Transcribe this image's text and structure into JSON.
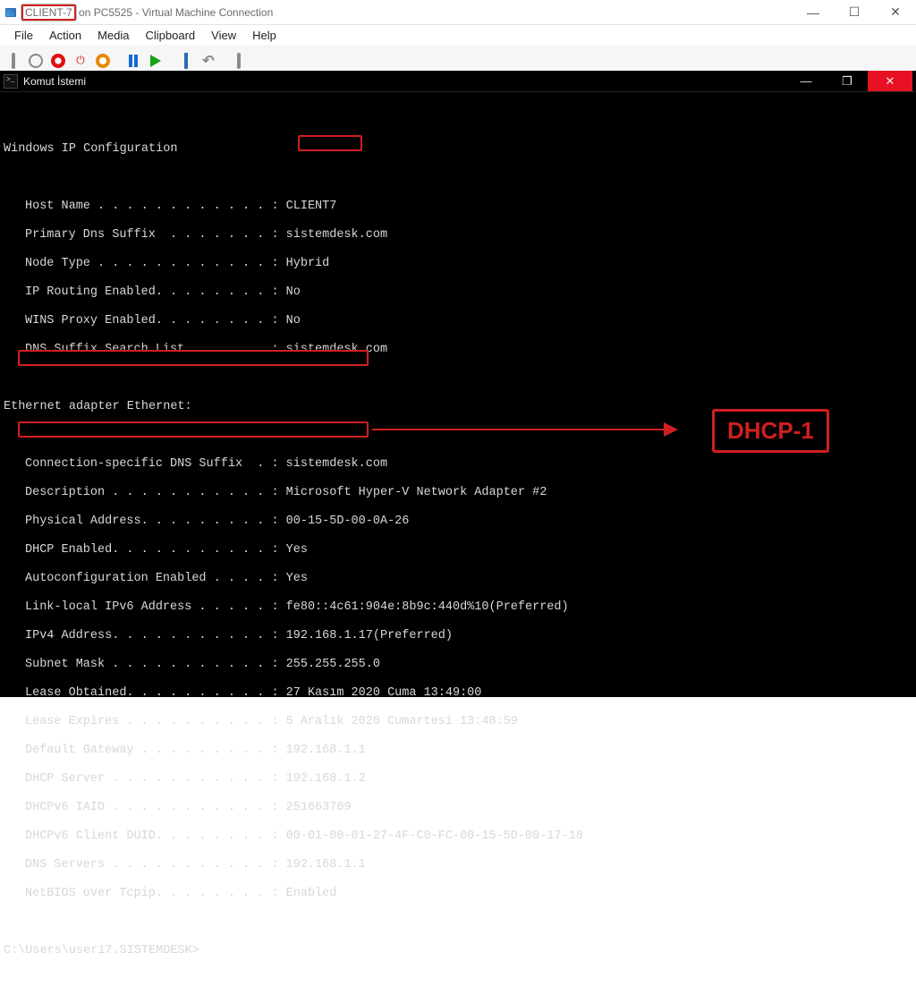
{
  "outer": {
    "title_highlight": "CLIENT-7",
    "title_rest": "on PC5525 - Virtual Machine Connection",
    "menu": [
      "File",
      "Action",
      "Media",
      "Clipboard",
      "View",
      "Help"
    ],
    "winbtn_min": "—",
    "winbtn_max": "☐",
    "winbtn_close": "✕"
  },
  "cmd": {
    "title": "Komut İstemi",
    "winbtn_min": "—",
    "winbtn_max": "❐",
    "winbtn_close": "✕",
    "section_winip": "Windows IP Configuration",
    "lines_winip": [
      {
        "key": "Host Name . . . . . . . . . . . . :",
        "val": " CLIENT7"
      },
      {
        "key": "Primary Dns Suffix  . . . . . . . :",
        "val": " sistemdesk.com"
      },
      {
        "key": "Node Type . . . . . . . . . . . . :",
        "val": " Hybrid"
      },
      {
        "key": "IP Routing Enabled. . . . . . . . :",
        "val": " No"
      },
      {
        "key": "WINS Proxy Enabled. . . . . . . . :",
        "val": " No"
      },
      {
        "key": "DNS Suffix Search List. . . . . . :",
        "val": " sistemdesk.com"
      }
    ],
    "section_eth": "Ethernet adapter Ethernet:",
    "lines_eth": [
      {
        "key": "Connection-specific DNS Suffix  . :",
        "val": " sistemdesk.com"
      },
      {
        "key": "Description . . . . . . . . . . . :",
        "val": " Microsoft Hyper-V Network Adapter #2"
      },
      {
        "key": "Physical Address. . . . . . . . . :",
        "val": " 00-15-5D-00-0A-26"
      },
      {
        "key": "DHCP Enabled. . . . . . . . . . . :",
        "val": " Yes"
      },
      {
        "key": "Autoconfiguration Enabled . . . . :",
        "val": " Yes"
      },
      {
        "key": "Link-local IPv6 Address . . . . . :",
        "val": " fe80::4c61:904e:8b9c:440d%10(Preferred)"
      },
      {
        "key": "IPv4 Address. . . . . . . . . . . :",
        "val": " 192.168.1.17(Preferred)"
      },
      {
        "key": "Subnet Mask . . . . . . . . . . . :",
        "val": " 255.255.255.0"
      },
      {
        "key": "Lease Obtained. . . . . . . . . . :",
        "val": " 27 Kasım 2020 Cuma 13:49:00"
      },
      {
        "key": "Lease Expires . . . . . . . . . . :",
        "val": " 5 Aralık 2020 Cumartesi 13:48:59"
      },
      {
        "key": "Default Gateway . . . . . . . . . :",
        "val": " 192.168.1.1"
      },
      {
        "key": "DHCP Server . . . . . . . . . . . :",
        "val": " 192.168.1.2"
      },
      {
        "key": "DHCPv6 IAID . . . . . . . . . . . :",
        "val": " 251663709"
      },
      {
        "key": "DHCPv6 Client DUID. . . . . . . . :",
        "val": " 00-01-00-01-27-4F-C0-FC-00-15-5D-00-17-18"
      },
      {
        "key": "DNS Servers . . . . . . . . . . . :",
        "val": " 192.168.1.1"
      },
      {
        "key": "NetBIOS over Tcpip. . . . . . . . :",
        "val": " Enabled"
      }
    ],
    "prompt": "C:\\Users\\user17.SISTEMDESK>",
    "annotation": "DHCP-1"
  }
}
